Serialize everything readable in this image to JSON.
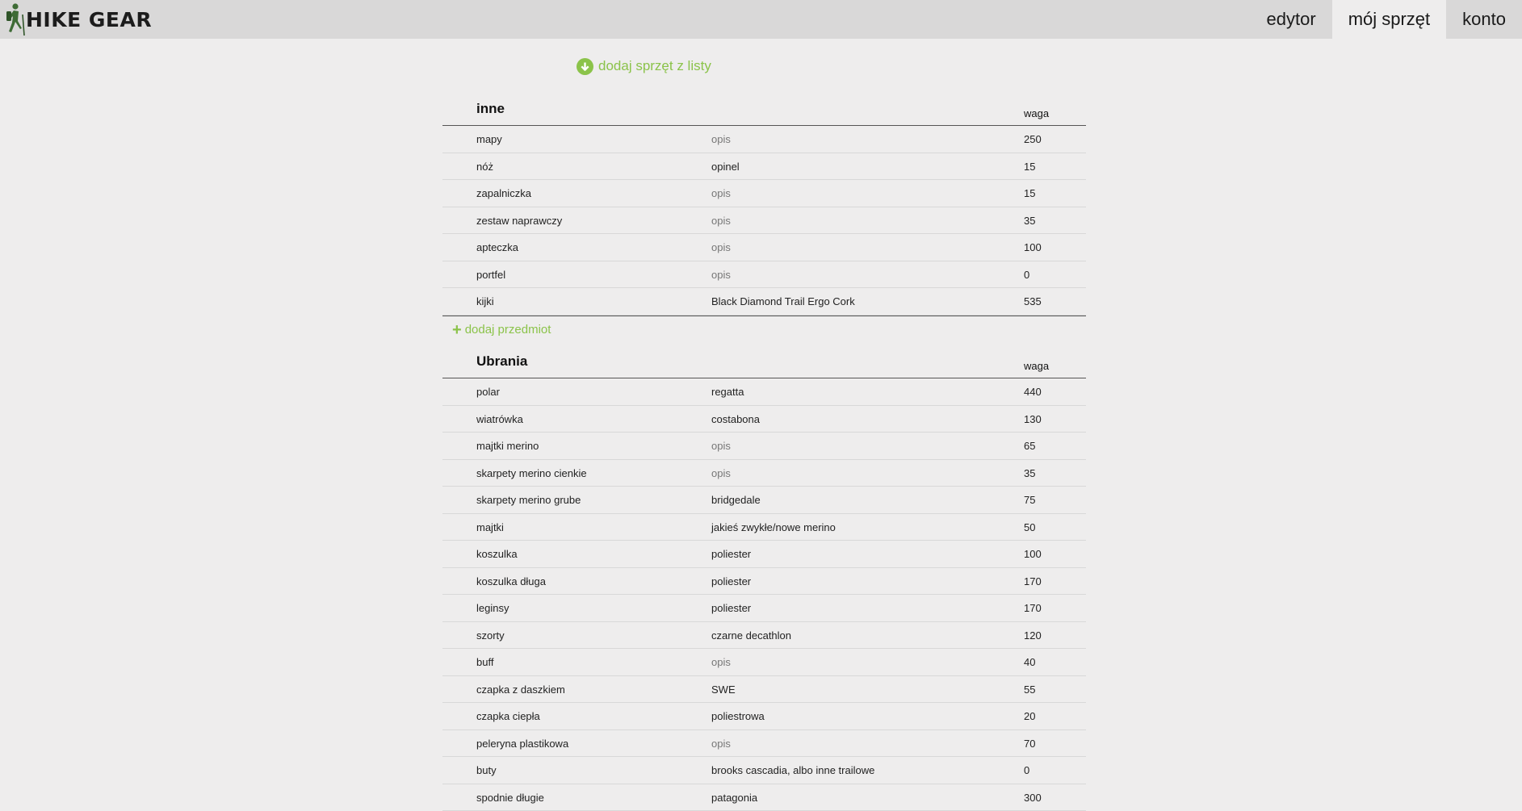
{
  "app": {
    "logo_text": "HIKE GEAR"
  },
  "nav": {
    "items": [
      "edytor",
      "mój sprzęt",
      "konto"
    ],
    "active": "mój sprzęt"
  },
  "add_from_list_label": "dodaj sprzęt z listy",
  "add_item_label": "dodaj przedmiot",
  "colors": {
    "accent": "#8bc34a",
    "topbar": "#d9d8d8",
    "background": "#eeeded"
  },
  "sections": [
    {
      "title": "inne",
      "weight_header": "waga",
      "items": [
        {
          "name": "mapy",
          "desc": "opis",
          "desc_placeholder": true,
          "weight": "250"
        },
        {
          "name": "nóż",
          "desc": "opinel",
          "desc_placeholder": false,
          "weight": "15"
        },
        {
          "name": "zapalniczka",
          "desc": "opis",
          "desc_placeholder": true,
          "weight": "15"
        },
        {
          "name": "zestaw naprawczy",
          "desc": "opis",
          "desc_placeholder": true,
          "weight": "35"
        },
        {
          "name": "apteczka",
          "desc": "opis",
          "desc_placeholder": true,
          "weight": "100"
        },
        {
          "name": "portfel",
          "desc": "opis",
          "desc_placeholder": true,
          "weight": "0"
        },
        {
          "name": "kijki",
          "desc": "Black Diamond Trail Ergo Cork",
          "desc_placeholder": false,
          "weight": "535"
        }
      ]
    },
    {
      "title": "Ubrania",
      "weight_header": "waga",
      "items": [
        {
          "name": "polar",
          "desc": "regatta",
          "desc_placeholder": false,
          "weight": "440"
        },
        {
          "name": "wiatrówka",
          "desc": "costabona",
          "desc_placeholder": false,
          "weight": "130"
        },
        {
          "name": "majtki merino",
          "desc": "opis",
          "desc_placeholder": true,
          "weight": "65"
        },
        {
          "name": "skarpety merino cienkie",
          "desc": "opis",
          "desc_placeholder": true,
          "weight": "35"
        },
        {
          "name": "skarpety merino grube",
          "desc": "bridgedale",
          "desc_placeholder": false,
          "weight": "75"
        },
        {
          "name": "majtki",
          "desc": "jakieś zwykłe/nowe merino",
          "desc_placeholder": false,
          "weight": "50"
        },
        {
          "name": "koszulka",
          "desc": "poliester",
          "desc_placeholder": false,
          "weight": "100"
        },
        {
          "name": "koszulka długa",
          "desc": "poliester",
          "desc_placeholder": false,
          "weight": "170"
        },
        {
          "name": "leginsy",
          "desc": "poliester",
          "desc_placeholder": false,
          "weight": "170"
        },
        {
          "name": "szorty",
          "desc": "czarne decathlon",
          "desc_placeholder": false,
          "weight": "120"
        },
        {
          "name": "buff",
          "desc": "opis",
          "desc_placeholder": true,
          "weight": "40"
        },
        {
          "name": "czapka z daszkiem",
          "desc": "SWE",
          "desc_placeholder": false,
          "weight": "55"
        },
        {
          "name": "czapka ciepła",
          "desc": "poliestrowa",
          "desc_placeholder": false,
          "weight": "20"
        },
        {
          "name": "peleryna plastikowa",
          "desc": "opis",
          "desc_placeholder": true,
          "weight": "70"
        },
        {
          "name": "buty",
          "desc": "brooks cascadia, albo inne trailowe",
          "desc_placeholder": false,
          "weight": "0"
        },
        {
          "name": "spodnie długie",
          "desc": "patagonia",
          "desc_placeholder": false,
          "weight": "300"
        }
      ]
    }
  ]
}
